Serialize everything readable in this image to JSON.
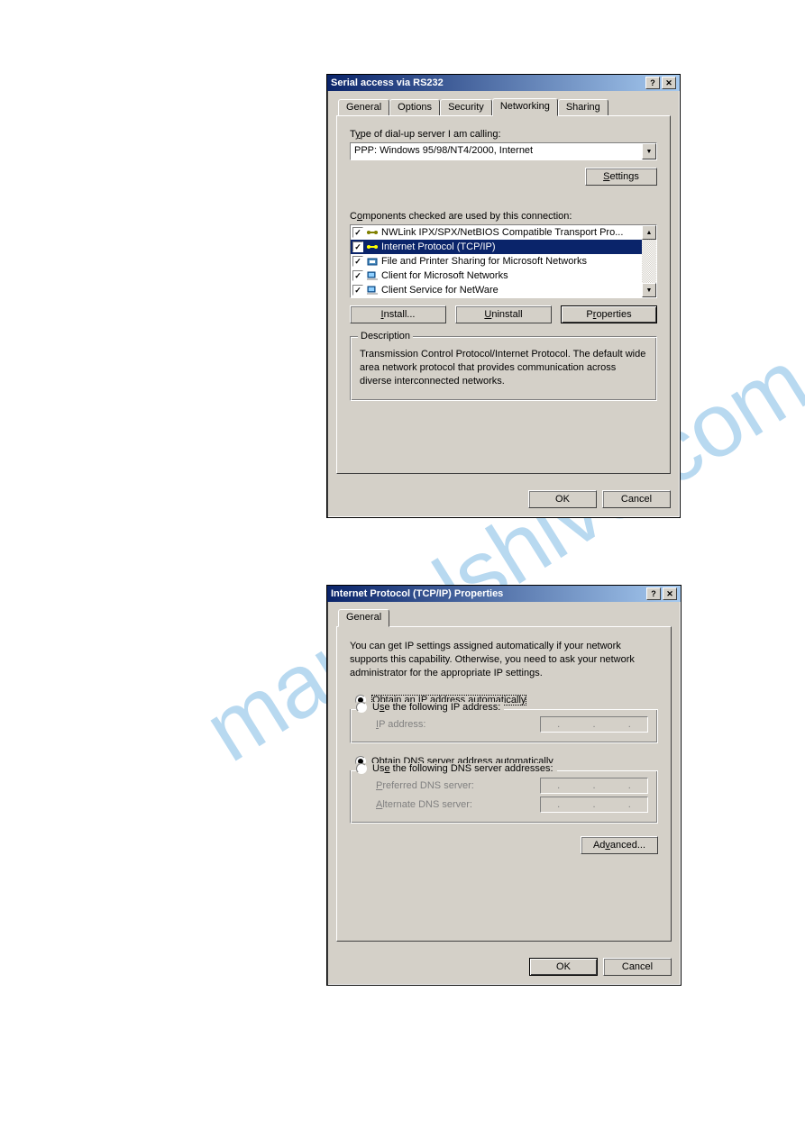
{
  "watermark": "manualshive.com",
  "dialog1": {
    "title": "Serial access via RS232",
    "tabs": [
      "General",
      "Options",
      "Security",
      "Networking",
      "Sharing"
    ],
    "active_tab_index": 3,
    "server_type_label": "Type of dial-up server I am calling:",
    "server_type_underline_char": "y",
    "server_type_value": "PPP: Windows 95/98/NT4/2000, Internet",
    "settings_btn": "Settings",
    "settings_underline_char": "S",
    "components_label": "Components checked are used by this connection:",
    "components_underline_char": "o",
    "components": [
      {
        "checked": true,
        "label": "NWLink IPX/SPX/NetBIOS Compatible Transport Pro...",
        "selected": false,
        "icon": "protocol"
      },
      {
        "checked": true,
        "label": "Internet Protocol (TCP/IP)",
        "selected": true,
        "icon": "protocol"
      },
      {
        "checked": true,
        "label": "File and Printer Sharing for Microsoft Networks",
        "selected": false,
        "icon": "service"
      },
      {
        "checked": true,
        "label": "Client for Microsoft Networks",
        "selected": false,
        "icon": "client"
      },
      {
        "checked": true,
        "label": "Client Service for NetWare",
        "selected": false,
        "icon": "client"
      }
    ],
    "install_btn": "Install...",
    "install_underline_char": "I",
    "uninstall_btn": "Uninstall",
    "uninstall_underline_char": "U",
    "properties_btn": "Properties",
    "properties_underline_char": "r",
    "desc_legend": "Description",
    "desc_text": "Transmission Control Protocol/Internet Protocol. The default wide area network protocol that provides communication across diverse interconnected networks.",
    "ok_btn": "OK",
    "cancel_btn": "Cancel"
  },
  "dialog2": {
    "title": "Internet Protocol (TCP/IP) Properties",
    "tabs": [
      "General"
    ],
    "active_tab_index": 0,
    "intro": "You can get IP settings assigned automatically if your network supports this capability. Otherwise, you need to ask your network administrator for the appropriate IP settings.",
    "ip_auto_label": "Obtain an IP address automatically",
    "ip_auto_underline": "O",
    "ip_manual_label": "Use the following IP address:",
    "ip_manual_underline": "s",
    "ip_addr_label": "IP address:",
    "ip_addr_underline": "I",
    "dns_auto_label": "Obtain DNS server address automatically",
    "dns_auto_underline": "b",
    "dns_manual_label": "Use the following DNS server addresses:",
    "dns_manual_underline": "e",
    "pref_dns_label": "Preferred DNS server:",
    "pref_dns_underline": "P",
    "alt_dns_label": "Alternate DNS server:",
    "alt_dns_underline": "A",
    "advanced_btn": "Advanced...",
    "advanced_underline": "v",
    "ok_btn": "OK",
    "cancel_btn": "Cancel",
    "ip_radio_selected": "auto",
    "dns_radio_selected": "auto"
  }
}
